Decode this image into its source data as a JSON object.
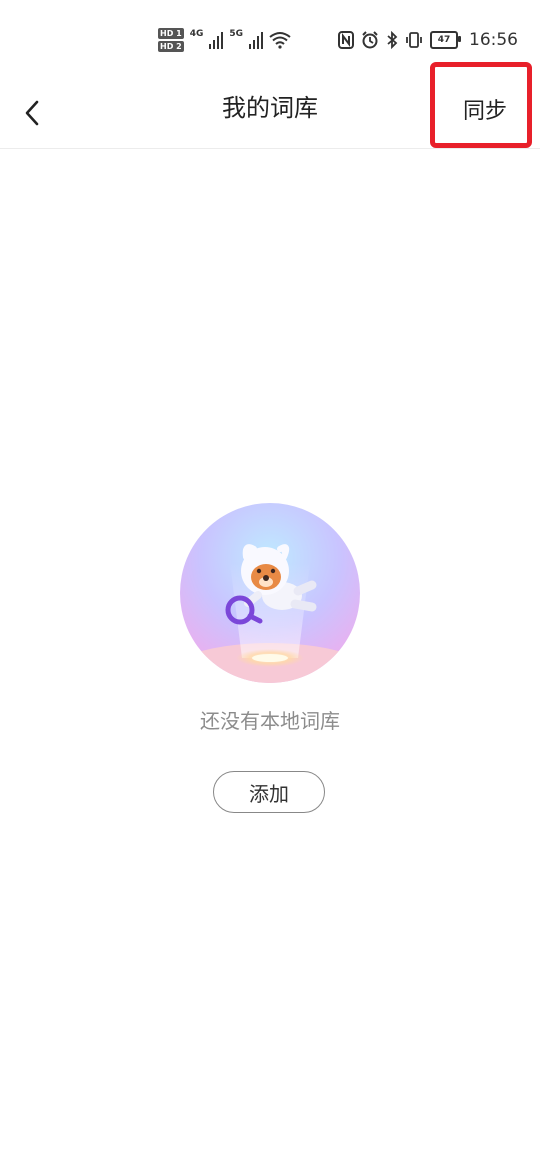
{
  "status_bar": {
    "hd1": "HD 1",
    "hd2": "HD 2",
    "net1": "4G",
    "net2": "5G",
    "battery_level": "47",
    "time": "16:56",
    "icons": [
      "nfc-icon",
      "alarm-icon",
      "bluetooth-icon",
      "vibrate-icon",
      "wifi-icon"
    ]
  },
  "header": {
    "title": "我的词库",
    "sync_label": "同步",
    "highlight_color": "#e8202a"
  },
  "empty_state": {
    "message": "还没有本地词库",
    "add_label": "添加"
  }
}
